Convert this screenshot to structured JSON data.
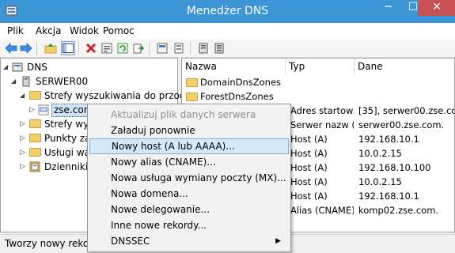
{
  "window": {
    "title": "Menedżer DNS",
    "minimize": "─",
    "maximize": "☐",
    "close": "✕"
  },
  "menu": [
    "Plik",
    "Akcja",
    "Widok",
    "Pomoc"
  ],
  "tree": {
    "root": "DNS",
    "server": "SERWER00",
    "forward_zones": "Strefy wyszukiwania do przodu",
    "zone": "zse.com",
    "reverse_zones": "Strefy wyszu",
    "trust_points": "Punkty za",
    "conditional": "Usługi wa",
    "logs": "Dzienniki"
  },
  "list": {
    "columns": [
      "Nazwa",
      "Typ",
      "Dane"
    ],
    "rows": [
      {
        "name": "DomainDnsZones",
        "type": "",
        "data": "",
        "folder": true
      },
      {
        "name": "ForestDnsZones",
        "type": "",
        "data": "",
        "folder": true
      },
      {
        "name": "",
        "type": "Adres startow...",
        "data": "[35], serwer00.zse.co"
      },
      {
        "name": "",
        "type": "Serwer nazw (...",
        "data": "serwer00.zse.com."
      },
      {
        "name": "",
        "type": "Host (A)",
        "data": "192.168.10.1"
      },
      {
        "name": "",
        "type": "Host (A)",
        "data": "10.0.2.15"
      },
      {
        "name": "",
        "type": "Host (A)",
        "data": "192.168.10.100"
      },
      {
        "name": "",
        "type": "Host (A)",
        "data": "10.0.2.15"
      },
      {
        "name": "",
        "type": "Host (A)",
        "data": "192.168.10.1"
      },
      {
        "name": "",
        "type": "Alias (CNAME)",
        "data": "komp02.zse.com."
      }
    ]
  },
  "context_menu": {
    "items": [
      {
        "label": "Aktualizuj plik danych serwera",
        "disabled": true
      },
      {
        "label": "Załaduj ponownie"
      },
      {
        "label": "Nowy host (A lub AAAA)...",
        "highlighted": true
      },
      {
        "label": "Nowy alias (CNAME)..."
      },
      {
        "label": "Nowa usługa wymiany poczty (MX)..."
      },
      {
        "label": "Nowa domena..."
      },
      {
        "label": "Nowe delegowanie..."
      },
      {
        "label": "Inne nowe rekordy..."
      },
      {
        "label": "DNSSEC",
        "submenu_arrow": "▶"
      }
    ]
  },
  "status": "Tworzy nowy rekord z",
  "colors": {
    "titlebar": "#3c95d5",
    "close": "#c75050",
    "highlight": "#d4e8fb",
    "highlight_border": "#84acdd"
  },
  "icons": {
    "toolbar": [
      "back-arrow-icon",
      "forward-arrow-icon",
      "up-folder-icon",
      "console-tree-icon",
      "delete-icon",
      "properties-icon",
      "refresh-icon",
      "export-icon",
      "help-icon",
      "filter-icon",
      "server-icon",
      "list-icon"
    ]
  }
}
